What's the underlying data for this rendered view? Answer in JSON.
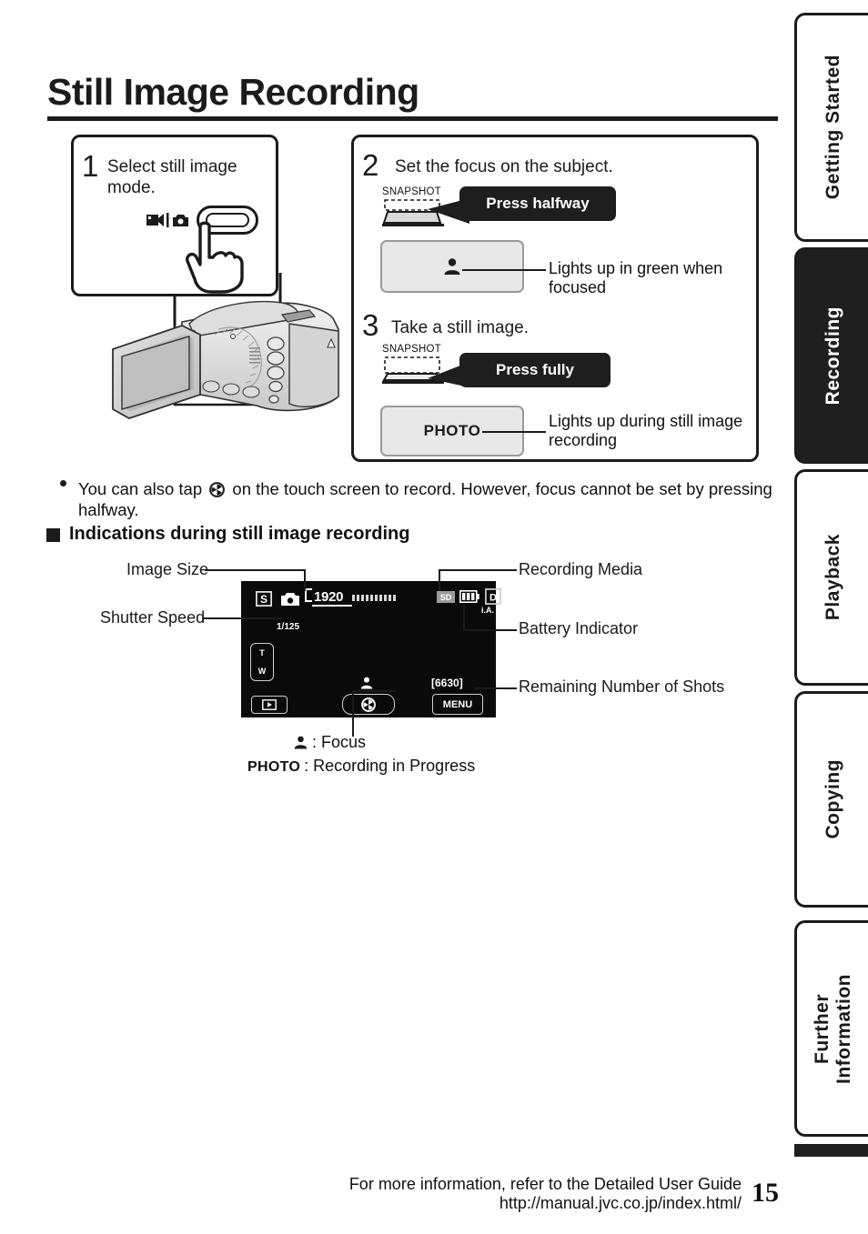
{
  "page_title": "Still Image Recording",
  "steps": [
    {
      "number": "1",
      "text": "Select still image mode.",
      "mode_icons": "video-photo-mode-icon"
    },
    {
      "number": "2",
      "text": "Set the focus on the subject.",
      "button_label": "SNAPSHOT",
      "callout": "Press halfway",
      "indicator_icon": "focus-person-icon",
      "indicator_note": "Lights up in green when focused"
    },
    {
      "number": "3",
      "text": "Take a still image.",
      "button_label": "SNAPSHOT",
      "callout": "Press fully",
      "indicator_text": "PHOTO",
      "indicator_note": "Lights up during still image recording"
    }
  ],
  "note": {
    "bullet_before": "You can also tap",
    "bullet_icon": "shutter-icon",
    "bullet_after": "on the touch screen to record. However, focus cannot be set by pressing halfway."
  },
  "subheading": "Indications during still image recording",
  "lcd": {
    "image_size": "1920",
    "shutter_speed": "1/125",
    "media": "SD",
    "mode_badge": "D",
    "mode_badge_sub": "i.A.",
    "zoom_tele": "T",
    "zoom_wide": "W",
    "remaining_shots": "[6630]",
    "menu_button": "MENU",
    "playback_button": "playback-icon",
    "shutter_button": "shutter-icon",
    "focus_icon": "focus-person-icon",
    "still_icon": "still-camera-icon",
    "s_icon": "S"
  },
  "lcd_labels": {
    "image_size": "Image Size",
    "shutter_speed": "Shutter Speed",
    "recording_media": "Recording Media",
    "battery_indicator": "Battery Indicator",
    "remaining_shots": "Remaining Number of Shots"
  },
  "legend": {
    "focus_label": ": Focus",
    "photo_key": "PHOTO",
    "photo_label": ": Recording in Progress"
  },
  "tabs": [
    {
      "label": "Getting Started",
      "active": false
    },
    {
      "label": "Recording",
      "active": true
    },
    {
      "label": "Playback",
      "active": false
    },
    {
      "label": "Copying",
      "active": false
    },
    {
      "label": "Further\nInformation",
      "active": false
    }
  ],
  "footer": {
    "line1": "For more information, refer to the Detailed User Guide",
    "line2": "http://manual.jvc.co.jp/index.html/",
    "page_number": "15"
  },
  "colors": {
    "ink": "#1b1b1b",
    "lcd_bg": "#0a0a0a",
    "indicator_bg": "#e8e8e8",
    "callout_bg": "#1e1e1e"
  }
}
